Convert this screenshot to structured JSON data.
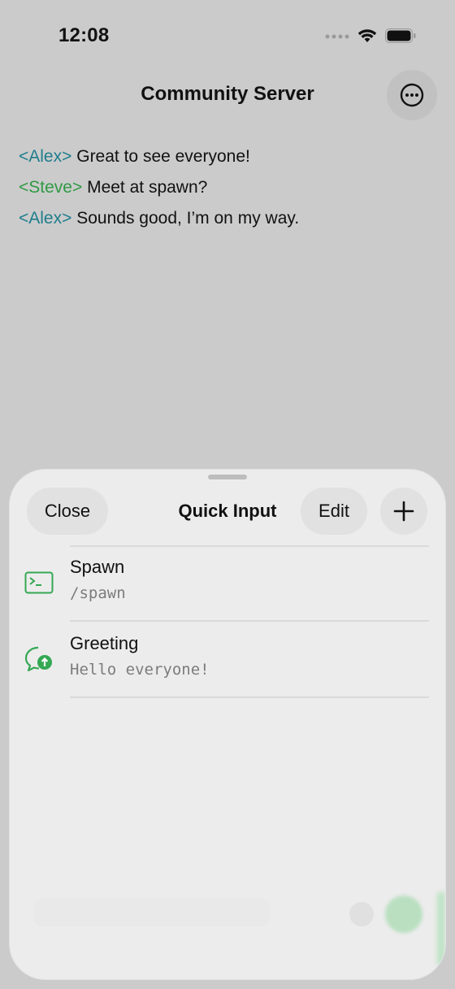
{
  "status_bar": {
    "time": "12:08"
  },
  "nav": {
    "title": "Community Server",
    "more_icon": "ellipsis-circle-icon"
  },
  "chat": {
    "messages": [
      {
        "name": "<Alex>",
        "text": "Great to see everyone!"
      },
      {
        "name": "<Steve>",
        "text": "Meet at spawn?"
      },
      {
        "name": "<Alex>",
        "text": "Sounds good, I’m on my way."
      }
    ]
  },
  "sheet": {
    "title": "Quick Input",
    "close_label": "Close",
    "edit_label": "Edit",
    "add_icon": "plus-icon",
    "items": [
      {
        "title": "Spawn",
        "value": "/spawn",
        "icon": "terminal-icon"
      },
      {
        "title": "Greeting",
        "value": "Hello everyone!",
        "icon": "chat-bubble-send-icon"
      }
    ]
  },
  "colors": {
    "alex": "#1e7d8c",
    "steve": "#2f9a45",
    "accent_green": "#34a853"
  }
}
